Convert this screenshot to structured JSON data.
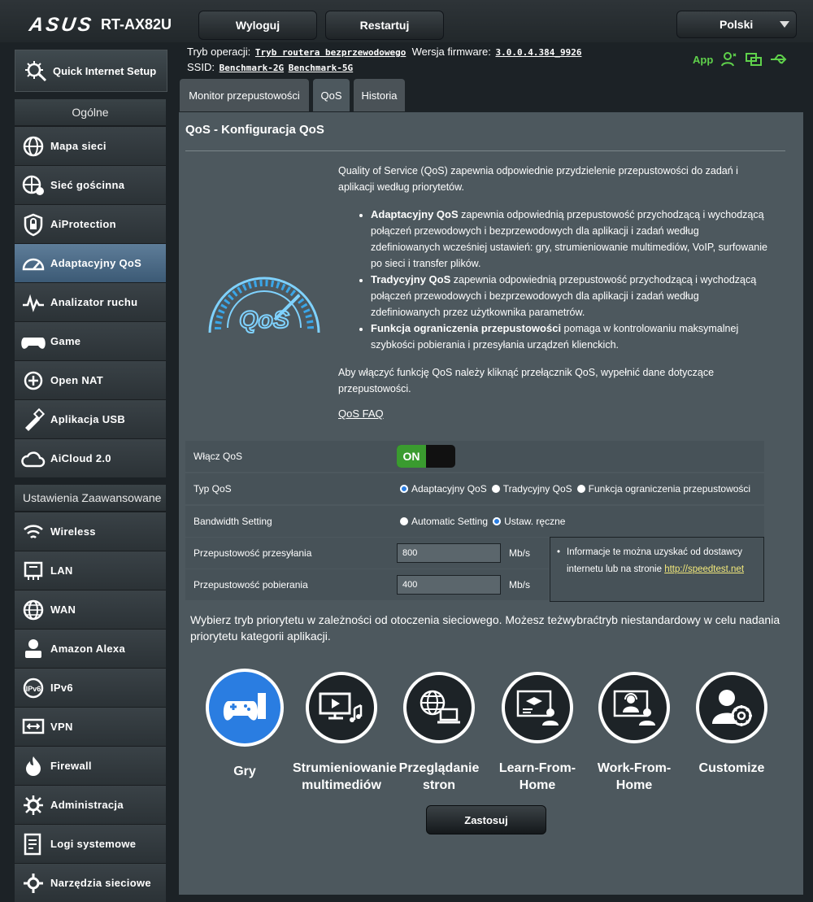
{
  "header": {
    "brand": "ASUS",
    "model": "RT-AX82U",
    "logout": "Wyloguj",
    "restart": "Restartuj",
    "language": "Polski"
  },
  "sidebar": {
    "quick_setup": "Quick Internet Setup",
    "general_title": "Ogólne",
    "general_items": [
      {
        "label": "Mapa sieci",
        "icon": "network-map-icon"
      },
      {
        "label": "Sieć gościnna",
        "icon": "guest-network-icon"
      },
      {
        "label": "AiProtection",
        "icon": "shield-lock-icon"
      },
      {
        "label": "Adaptacyjny QoS",
        "icon": "speedometer-icon",
        "active": true
      },
      {
        "label": "Analizator ruchu",
        "icon": "traffic-analyzer-icon"
      },
      {
        "label": "Game",
        "icon": "gamepad-icon"
      },
      {
        "label": "Open NAT",
        "icon": "open-nat-icon"
      },
      {
        "label": "Aplikacja USB",
        "icon": "usb-app-icon"
      },
      {
        "label": "AiCloud 2.0",
        "icon": "cloud-icon"
      }
    ],
    "advanced_title": "Ustawienia Zaawansowane",
    "advanced_items": [
      {
        "label": "Wireless",
        "icon": "wifi-icon"
      },
      {
        "label": "LAN",
        "icon": "lan-icon"
      },
      {
        "label": "WAN",
        "icon": "globe-icon"
      },
      {
        "label": "Amazon Alexa",
        "icon": "alexa-icon"
      },
      {
        "label": "IPv6",
        "icon": "ipv6-icon"
      },
      {
        "label": "VPN",
        "icon": "vpn-icon"
      },
      {
        "label": "Firewall",
        "icon": "firewall-icon"
      },
      {
        "label": "Administracja",
        "icon": "admin-gear-icon"
      },
      {
        "label": "Logi systemowe",
        "icon": "system-log-icon"
      },
      {
        "label": "Narzędzia sieciowe",
        "icon": "network-tools-icon"
      }
    ]
  },
  "status": {
    "op_mode_label": "Tryb operacji:",
    "op_mode_value": "Tryb routera bezprzewodowego",
    "firmware_label": "Wersja firmware:",
    "firmware_value": "3.0.0.4.384_9926",
    "ssid_label": "SSID:",
    "ssid_2g": "Benchmark-2G",
    "ssid_5g": "Benchmark-5G",
    "app_label": "App"
  },
  "tabs": [
    "Monitor przepustowości",
    "QoS",
    "Historia"
  ],
  "qos": {
    "title": "QoS - Konfiguracja QoS",
    "intro": "Quality of Service (QoS) zapewnia odpowiednie przydzielenie przepustowości do zadań i aplikacji według priorytetów.",
    "bullets": [
      {
        "bold": "Adaptacyjny QoS",
        "text": " zapewnia odpowiednią przepustowość przychodzącą i wychodzącą połączeń przewodowych i bezprzewodowych dla aplikacji i zadań według zdefiniowanych wcześniej ustawień: gry, strumieniowanie multimediów, VoIP, surfowanie po sieci i transfer plików."
      },
      {
        "bold": "Tradycyjny QoS",
        "text": " zapewnia odpowiednią przepustowość przychodzącą i wychodzącą połączeń przewodowych i bezprzewodowych dla aplikacji i zadań według zdefiniowanych przez użytkownika parametrów."
      },
      {
        "bold": "Funkcja ograniczenia przepustowości",
        "text": " pomaga w kontrolowaniu maksymalnej szybkości pobierania i przesyłania urządzeń klienckich."
      }
    ],
    "enable_hint": "Aby włączyć funkcję QoS należy kliknąć przełącznik QoS, wypełnić dane dotyczące przepustowości.",
    "faq": "QoS FAQ",
    "logo_text": "QoS",
    "settings": {
      "enable_label": "Włącz QoS",
      "enable_value": "ON",
      "type_label": "Typ QoS",
      "type_options": [
        "Adaptacyjny QoS",
        "Tradycyjny QoS",
        "Funkcja ograniczenia przepustowości"
      ],
      "type_selected": 0,
      "bandwidth_label": "Bandwidth Setting",
      "bandwidth_options": [
        "Automatic Setting",
        "Ustaw. ręczne"
      ],
      "bandwidth_selected": 1,
      "upload_label": "Przepustowość przesyłania",
      "upload_value": "800",
      "download_label": "Przepustowość pobierania",
      "download_value": "400",
      "unit": "Mb/s",
      "info_text": "Informacje te można uzyskać od dostawcy internetu lub na stronie",
      "info_link": "http://speedtest.net"
    },
    "priority_text": "Wybierz tryb priorytetu w zależności od otoczenia sieciowego. Możesz teżwybraćtryb niestandardowy w celu nadania priorytetu kategorii aplikacji.",
    "modes": [
      {
        "label": "Gry",
        "icon": "gamepad-icon",
        "selected": true
      },
      {
        "label": "Strumieniowanie multimediów",
        "icon": "media-streaming-icon"
      },
      {
        "label": "Przeglądanie stron",
        "icon": "web-browsing-icon"
      },
      {
        "label": "Learn-From-Home",
        "icon": "learn-from-home-icon"
      },
      {
        "label": "Work-From-Home",
        "icon": "work-from-home-icon"
      },
      {
        "label": "Customize",
        "icon": "customize-icon"
      }
    ],
    "apply": "Zastosuj"
  },
  "colors": {
    "accent": "#2a7de1",
    "green": "#3a9b2f",
    "panel": "#4d585e",
    "link": "#f3e97b"
  }
}
